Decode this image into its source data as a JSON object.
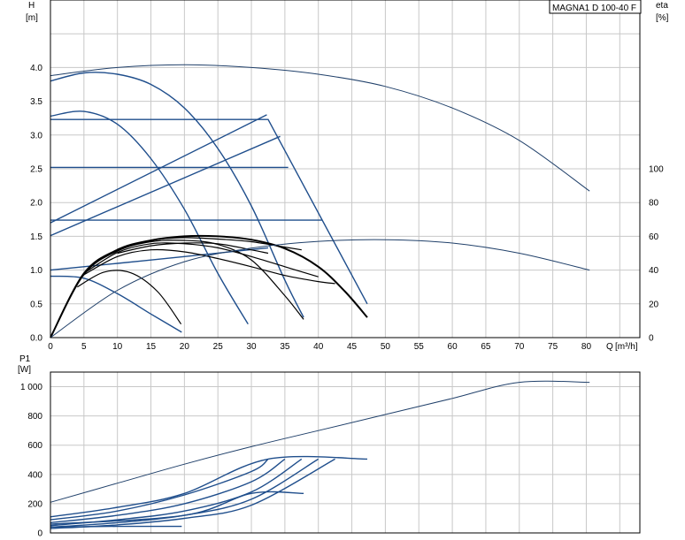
{
  "chart_data": [
    {
      "type": "line",
      "title": "MAGNA1 D 100-40 F",
      "ylabel": "H",
      "yunit": "[m]",
      "xlabel": "Q",
      "xunit": "[m³/h]",
      "y2label": "eta",
      "y2unit": "[%]",
      "xlim": [
        0,
        88
      ],
      "ylim": [
        0,
        5
      ],
      "y2lim": [
        0,
        200
      ],
      "xticks": [
        "0",
        "5",
        "10",
        "15",
        "20",
        "25",
        "30",
        "35",
        "40",
        "45",
        "50",
        "55",
        "60",
        "65",
        "70",
        "75",
        "80"
      ],
      "yticks": [
        "0.0",
        "0.5",
        "1.0",
        "1.5",
        "2.0",
        "2.5",
        "3.0",
        "3.5",
        "4.0"
      ],
      "y2ticks": [
        "0",
        "20",
        "40",
        "60",
        "80",
        "100"
      ],
      "grid": true,
      "series": [
        {
          "kind": "thin",
          "axis": "H",
          "x": [
            0,
            10,
            20,
            30,
            40,
            50,
            60,
            70,
            80.5
          ],
          "y": [
            3.88,
            4.0,
            4.04,
            4.0,
            3.9,
            3.72,
            3.4,
            2.92,
            2.17
          ]
        },
        {
          "kind": "blue",
          "axis": "H",
          "x": [
            0,
            5,
            10,
            15,
            20,
            25,
            30,
            35,
            37.8
          ],
          "y": [
            3.8,
            3.92,
            3.9,
            3.75,
            3.4,
            2.8,
            1.95,
            0.85,
            0.3
          ]
        },
        {
          "kind": "blue",
          "axis": "H",
          "x": [
            0,
            5,
            10,
            15,
            19.6
          ],
          "y": [
            0.91,
            0.88,
            0.65,
            0.35,
            0.08
          ]
        },
        {
          "kind": "blue",
          "axis": "H",
          "x": [
            0,
            5,
            10,
            15,
            20,
            25,
            29.5
          ],
          "y": [
            3.28,
            3.35,
            3.16,
            2.65,
            1.9,
            0.95,
            0.2
          ]
        },
        {
          "kind": "blue",
          "axis": "H",
          "x": [
            0,
            32.5,
            47.3
          ],
          "y": [
            3.23,
            3.23,
            0.5
          ]
        },
        {
          "kind": "blue",
          "axis": "H",
          "x": [
            0,
            35.5
          ],
          "y": [
            2.52,
            2.52
          ]
        },
        {
          "kind": "blue",
          "axis": "H",
          "x": [
            0,
            40.5
          ],
          "y": [
            1.74,
            1.74
          ]
        },
        {
          "kind": "blue",
          "axis": "H",
          "x": [
            0,
            32.3
          ],
          "y": [
            1.7,
            3.3
          ]
        },
        {
          "kind": "blue",
          "axis": "H",
          "x": [
            0,
            34.3
          ],
          "y": [
            1.51,
            2.98
          ]
        },
        {
          "kind": "blue",
          "axis": "H",
          "x": [
            0,
            10,
            20,
            32.5
          ],
          "y": [
            1.0,
            1.1,
            1.2,
            1.33
          ]
        },
        {
          "kind": "bold",
          "axis": "H",
          "x": [
            0,
            5,
            10,
            15,
            20,
            25,
            30,
            35,
            40,
            44,
            47.3
          ],
          "y": [
            0,
            0.95,
            1.3,
            1.44,
            1.5,
            1.5,
            1.45,
            1.32,
            1.05,
            0.68,
            0.3
          ]
        },
        {
          "kind": "black",
          "axis": "H",
          "x": [
            0,
            5,
            10,
            15,
            20,
            25,
            30,
            35,
            37.8
          ],
          "y": [
            0,
            0.93,
            1.28,
            1.42,
            1.44,
            1.38,
            1.15,
            0.62,
            0.27
          ]
        },
        {
          "kind": "black",
          "axis": "H",
          "x": [
            5,
            10,
            15,
            20,
            25,
            30,
            35,
            40,
            42.5
          ],
          "y": [
            0.93,
            1.2,
            1.3,
            1.27,
            1.17,
            1.05,
            0.92,
            0.83,
            0.8
          ]
        },
        {
          "kind": "black",
          "axis": "H",
          "x": [
            5,
            10,
            15,
            20,
            25,
            30,
            35,
            40
          ],
          "y": [
            0.95,
            1.26,
            1.39,
            1.39,
            1.33,
            1.2,
            1.05,
            0.9
          ]
        },
        {
          "kind": "black",
          "axis": "H",
          "x": [
            10,
            15,
            20,
            25,
            30,
            35,
            37.5
          ],
          "y": [
            1.31,
            1.44,
            1.48,
            1.46,
            1.42,
            1.34,
            1.3
          ]
        },
        {
          "kind": "black",
          "axis": "H",
          "x": [
            10,
            15,
            20,
            25,
            30,
            32.5
          ],
          "y": [
            1.25,
            1.36,
            1.4,
            1.39,
            1.3,
            1.25
          ]
        },
        {
          "kind": "black",
          "axis": "H",
          "x": [
            4,
            8,
            12,
            16,
            19.5
          ],
          "y": [
            0.75,
            0.97,
            0.96,
            0.68,
            0.2
          ]
        },
        {
          "kind": "thin",
          "axis": "eta",
          "x": [
            0,
            10,
            20,
            30,
            40,
            50,
            60,
            70,
            80.5
          ],
          "y": [
            0,
            28,
            45,
            53,
            57,
            58,
            56,
            50,
            40
          ]
        }
      ]
    },
    {
      "type": "line",
      "ylabel": "P1",
      "yunit": "[W]",
      "xlim": [
        0,
        88
      ],
      "ylim": [
        0,
        1100
      ],
      "yticks": [
        "0",
        "200",
        "400",
        "600",
        "800",
        "1 000"
      ],
      "grid": true,
      "series": [
        {
          "kind": "thin",
          "x": [
            0,
            10,
            20,
            30,
            40,
            50,
            60,
            70,
            80.5
          ],
          "y": [
            210,
            340,
            470,
            590,
            700,
            810,
            920,
            1030,
            1030
          ]
        },
        {
          "kind": "blue",
          "x": [
            0,
            10,
            20,
            32.5,
            47.3
          ],
          "y": [
            110,
            175,
            270,
            505,
            505
          ]
        },
        {
          "kind": "blue",
          "x": [
            0,
            10,
            20,
            30,
            32.5
          ],
          "y": [
            90,
            150,
            260,
            420,
            505
          ]
        },
        {
          "kind": "blue",
          "x": [
            0,
            10,
            20,
            30,
            35
          ],
          "y": [
            70,
            120,
            200,
            350,
            505
          ]
        },
        {
          "kind": "blue",
          "x": [
            0,
            10,
            20,
            30,
            37.5
          ],
          "y": [
            50,
            90,
            150,
            280,
            505
          ]
        },
        {
          "kind": "blue",
          "x": [
            0,
            10,
            20,
            30,
            40
          ],
          "y": [
            40,
            70,
            120,
            230,
            505
          ]
        },
        {
          "kind": "blue",
          "x": [
            0,
            10,
            20,
            30,
            42.5
          ],
          "y": [
            30,
            55,
            100,
            190,
            505
          ]
        },
        {
          "kind": "blue",
          "x": [
            0,
            20,
            30,
            37.8
          ],
          "y": [
            60,
            120,
            270,
            270
          ]
        },
        {
          "kind": "blue",
          "x": [
            0,
            10,
            19.6
          ],
          "y": [
            40,
            45,
            45
          ]
        }
      ]
    }
  ]
}
